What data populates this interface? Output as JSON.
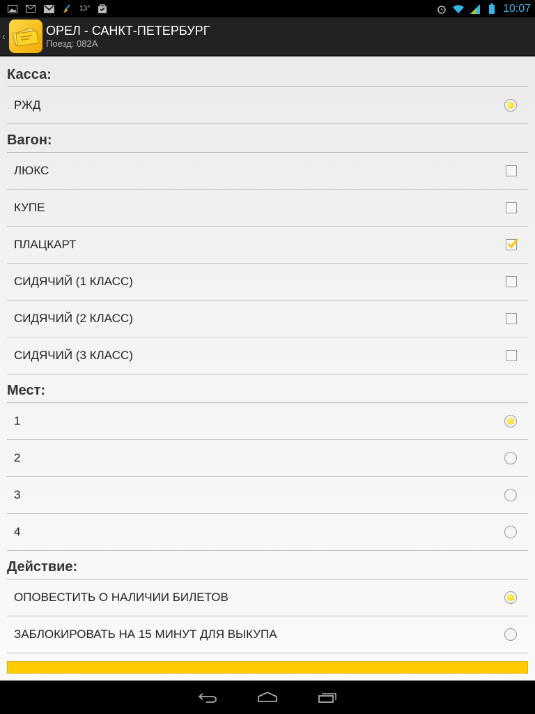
{
  "status_bar": {
    "temperature": "13°",
    "time": "10:07",
    "left_icons": [
      "image-icon",
      "mail-icon",
      "gmail-icon",
      "broom-icon",
      "temperature",
      "bag-icon"
    ],
    "right_icons": [
      "alarm-icon",
      "wifi-icon",
      "signal-icon",
      "battery-icon"
    ]
  },
  "action_bar": {
    "title": "ОРЕЛ - САНКТ-ПЕТЕРБУРГ",
    "subtitle": "Поезд: 082А"
  },
  "sections": {
    "kassa": {
      "title": "Касса:",
      "items": [
        {
          "label": "РЖД",
          "checked": true
        }
      ]
    },
    "vagon": {
      "title": "Вагон:",
      "items": [
        {
          "label": "ЛЮКС",
          "checked": false
        },
        {
          "label": "КУПЕ",
          "checked": false
        },
        {
          "label": "ПЛАЦКАРТ",
          "checked": true
        },
        {
          "label": "СИДЯЧИЙ (1 КЛАСС)",
          "checked": false
        },
        {
          "label": "СИДЯЧИЙ (2 КЛАСС)",
          "checked": false
        },
        {
          "label": "СИДЯЧИЙ (3 КЛАСС)",
          "checked": false
        }
      ]
    },
    "mest": {
      "title": "Мест:",
      "items": [
        {
          "label": "1",
          "checked": true
        },
        {
          "label": "2",
          "checked": false
        },
        {
          "label": "3",
          "checked": false
        },
        {
          "label": "4",
          "checked": false
        }
      ]
    },
    "deystvie": {
      "title": "Действие:",
      "items": [
        {
          "label": "ОПОВЕСТИТЬ О НАЛИЧИИ БИЛЕТОВ",
          "checked": true
        },
        {
          "label": "ЗАБЛОКИРОВАТЬ НА 15 МИНУТ ДЛЯ ВЫКУПА",
          "checked": false
        }
      ]
    }
  },
  "colors": {
    "accent": "#ffcc00",
    "action_bar": "#222222",
    "status_time": "#33b5e5"
  },
  "nav_bar": {
    "buttons": [
      "back-icon",
      "home-icon",
      "recent-apps-icon"
    ]
  }
}
